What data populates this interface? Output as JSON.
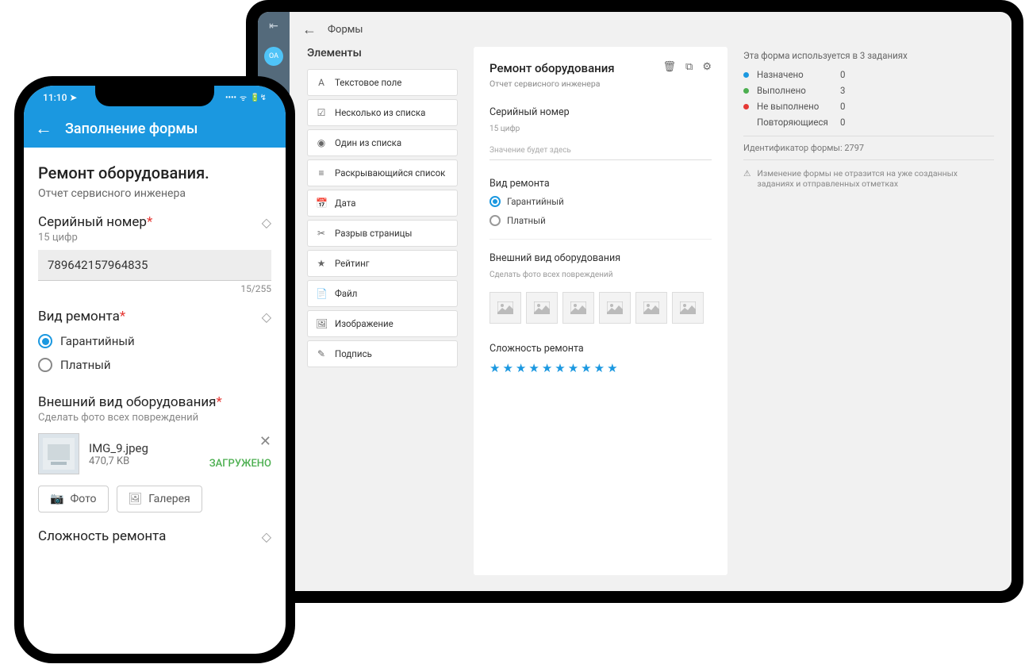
{
  "tablet": {
    "avatar_initials": "OA",
    "header_title": "Формы",
    "elements_title": "Элементы",
    "elements": [
      {
        "icon": "A",
        "label": "Текстовое поле"
      },
      {
        "icon": "☑",
        "label": "Несколько из списка"
      },
      {
        "icon": "◉",
        "label": "Один из списка"
      },
      {
        "icon": "≡",
        "label": "Раскрывающийся список"
      },
      {
        "icon": "📅",
        "label": "Дата"
      },
      {
        "icon": "✂",
        "label": "Разрыв страницы"
      },
      {
        "icon": "★",
        "label": "Рейтинг"
      },
      {
        "icon": "📄",
        "label": "Файл"
      },
      {
        "icon": "🖼",
        "label": "Изображение"
      },
      {
        "icon": "✎",
        "label": "Подпись"
      }
    ],
    "form": {
      "title": "Ремонт оборудования",
      "subtitle": "Отчет сервисного инженера",
      "serial_label": "Серийный номер",
      "serial_hint": "15 цифр",
      "serial_placeholder": "Значение будет здесь",
      "repair_label": "Вид ремонта",
      "repair_opt1": "Гарантийный",
      "repair_opt2": "Платный",
      "appearance_label": "Внешний вид оборудования",
      "appearance_hint": "Сделать фото всех повреждений",
      "complexity_label": "Сложность ремонта"
    },
    "side": {
      "usage_text": "Эта форма используется в 3 заданиях",
      "statuses": [
        {
          "color": "#1b98e0",
          "label": "Назначено",
          "count": "0"
        },
        {
          "color": "#4caf50",
          "label": "Выполнено",
          "count": "3"
        },
        {
          "color": "#e53935",
          "label": "Не выполнено",
          "count": "0"
        },
        {
          "color": "transparent",
          "label": "Повторяющиеся",
          "count": "0"
        }
      ],
      "form_id": "Идентификатор формы: 2797",
      "warning": "Изменение формы не отразится на уже созданных заданиях и отправленных отметках"
    }
  },
  "phone": {
    "time": "11:10",
    "appbar_title": "Заполнение формы",
    "title": "Ремонт оборудования.",
    "subtitle": "Отчет сервисного инженера",
    "serial_label": "Серийный номер",
    "serial_hint": "15 цифр",
    "serial_value": "789642157964835",
    "serial_counter": "15/255",
    "repair_label": "Вид ремонта",
    "repair_opt1": "Гарантийный",
    "repair_opt2": "Платный",
    "appearance_label": "Внешний вид оборудования",
    "appearance_hint": "Сделать фото всех повреждений",
    "file_name": "IMG_9.jpeg",
    "file_size": "470,7 KB",
    "file_status": "ЗАГРУЖЕНО",
    "btn_photo": "Фото",
    "btn_gallery": "Галерея",
    "complexity_label": "Сложность ремонта",
    "asterisk": "*"
  }
}
